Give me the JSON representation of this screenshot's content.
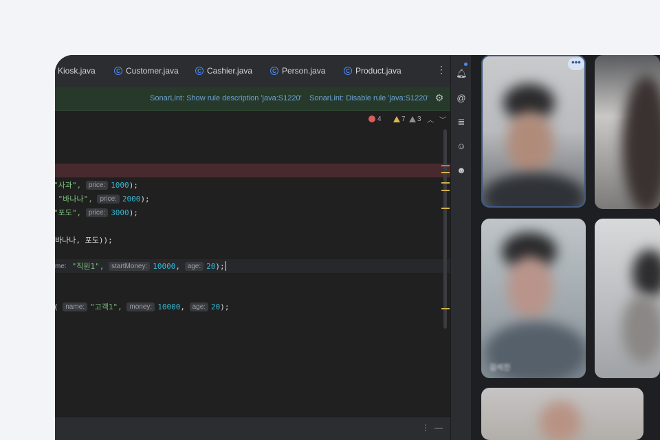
{
  "tabs": [
    {
      "label": "Kiosk.java"
    },
    {
      "label": "Customer.java"
    },
    {
      "label": "Cashier.java"
    },
    {
      "label": "Person.java"
    },
    {
      "label": "Product.java"
    }
  ],
  "tab_icon_glyph": "C",
  "sonarlint": {
    "show_rule": "SonarLint: Show rule description 'java:S1220'",
    "disable_rule": "SonarLint: Disable rule 'java:S1220'"
  },
  "inspections": {
    "errors": "4",
    "warnings": "7",
    "weak_warnings": "3"
  },
  "code": {
    "line1": {
      "str": "\"사과\", ",
      "hint": "price:",
      "num": "1000",
      "tail": ");"
    },
    "line2": {
      "str": " \"바나나\", ",
      "hint": "price:",
      "num": "2000",
      "tail": ");"
    },
    "line3": {
      "str": "\"포도\", ",
      "hint": "price:",
      "num": "3000",
      "tail": ");"
    },
    "line4": {
      "text": "바나나, 포도));"
    },
    "line5": {
      "h1": "me:",
      "s1": "\"직원1\", ",
      "h2": "startMoney:",
      "n2": "10000",
      "h3": "age:",
      "n3": "20",
      "tail": ");"
    },
    "line6": {
      "lead": "( ",
      "h1": "name:",
      "s1": "\"고객1\", ",
      "h2": "money:",
      "n2": "10000",
      "h3": "age:",
      "n3": "20",
      "tail": ");"
    }
  },
  "colors": {
    "accent": "#4c8bf5",
    "sonar_bar": "#26392b",
    "error_line": "#482a2e",
    "string": "#7fc07f",
    "number": "#36b8d4"
  },
  "tool_icons": [
    "notifications-icon",
    "ai-assistant-icon",
    "database-icon",
    "copilot-icon",
    "copilot-chat-icon"
  ],
  "video": {
    "tile3_name": "김석진"
  }
}
